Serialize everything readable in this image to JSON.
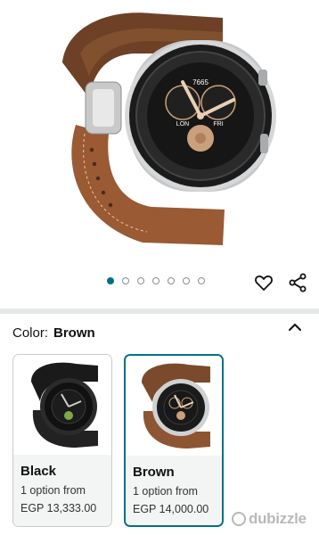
{
  "gallery": {
    "image_alt": "Brown leather strap smartwatch with silver case",
    "watch_face": {
      "top_number": "7665",
      "left_label": "LON",
      "right_label": "FRI"
    },
    "dot_count": 7,
    "active_dot": 0
  },
  "variation": {
    "label": "Color:",
    "selected": "Brown"
  },
  "options": [
    {
      "name": "Black",
      "availability": "1 option from",
      "price": "EGP 13,333.00",
      "selected": false
    },
    {
      "name": "Brown",
      "availability": "1 option from",
      "price": "EGP 14,000.00",
      "selected": true
    }
  ],
  "watermark": {
    "text": "dubizzle"
  },
  "colors": {
    "accent": "#007185",
    "strap_brown": "#7b4a2c",
    "bezel": "#1b1b1b"
  }
}
